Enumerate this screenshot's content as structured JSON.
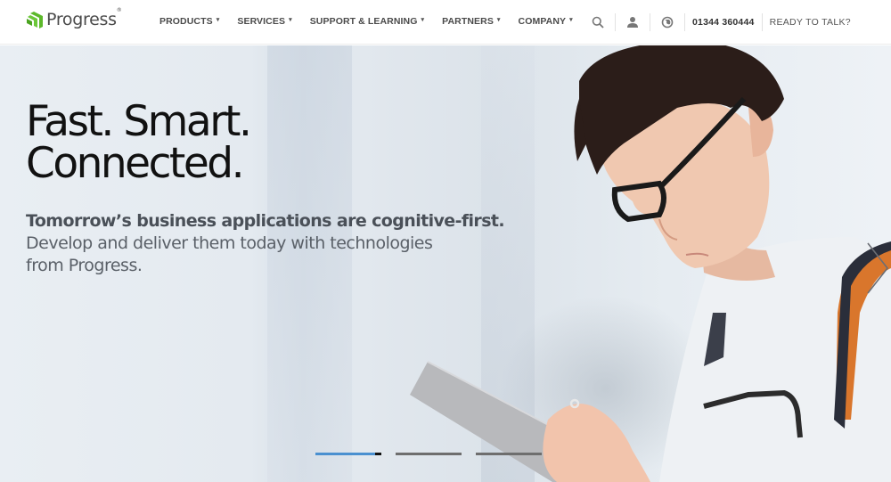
{
  "header": {
    "logo_text": "Progress",
    "logo_mark": "®",
    "brand_color": "#5ce500",
    "nav": [
      {
        "label": "PRODUCTS"
      },
      {
        "label": "SERVICES"
      },
      {
        "label": "SUPPORT & LEARNING"
      },
      {
        "label": "PARTNERS"
      },
      {
        "label": "COMPANY"
      }
    ],
    "caret_glyph": "▾",
    "utilities": {
      "search_icon": "search-icon",
      "user_icon": "user-icon",
      "globe_icon": "globe-icon",
      "phone": "01344 360444",
      "cta": "READY TO TALK?"
    }
  },
  "hero": {
    "headline_line1": "Fast. Smart.",
    "headline_line2": "Connected.",
    "subheadline": "Tomorrow’s business applications are cognitive-first.",
    "body_line1": "Develop and deliver them today with technologies",
    "body_line2": "from Progress.",
    "next_icon": "chevron-right-icon"
  },
  "carousel": {
    "slides": 3,
    "active_index": 0,
    "active_progress": 0.9,
    "progress_color": "#4a90d0"
  }
}
